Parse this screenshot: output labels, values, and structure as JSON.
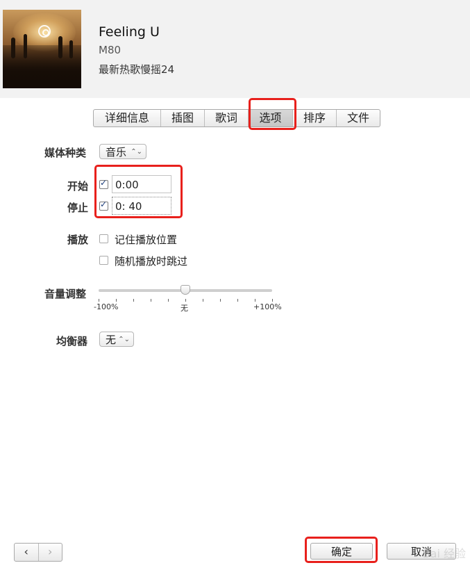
{
  "song": {
    "title": "Feeling U",
    "artist": "M80",
    "album": "最新热歌慢摇24"
  },
  "tabs": [
    {
      "label": "详细信息",
      "active": false
    },
    {
      "label": "插图",
      "active": false
    },
    {
      "label": "歌词",
      "active": false
    },
    {
      "label": "选项",
      "active": true
    },
    {
      "label": "排序",
      "active": false
    },
    {
      "label": "文件",
      "active": false
    }
  ],
  "media_kind": {
    "label": "媒体种类",
    "value": "音乐"
  },
  "start": {
    "label": "开始",
    "checked": true,
    "value": "0:00"
  },
  "stop": {
    "label": "停止",
    "checked": true,
    "value": "0: 40"
  },
  "playback": {
    "label": "播放",
    "options": [
      {
        "label": "记住播放位置",
        "checked": false
      },
      {
        "label": "随机播放时跳过",
        "checked": false
      }
    ]
  },
  "volume": {
    "label": "音量调整",
    "min_label": "-100%",
    "mid_label": "无",
    "max_label": "+100%",
    "value_percent": 0
  },
  "equalizer": {
    "label": "均衡器",
    "value": "无"
  },
  "footer": {
    "prev_icon": "chevron-left-icon",
    "next_icon": "chevron-right-icon",
    "ok_label": "确定",
    "cancel_label": "取消"
  },
  "annotation_color": "#e8201c",
  "watermark": "Bai 经验"
}
